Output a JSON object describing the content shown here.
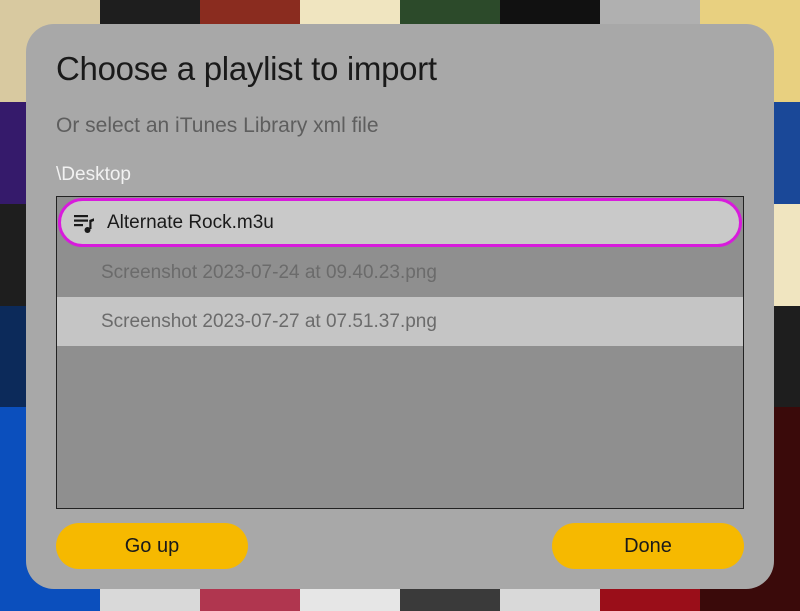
{
  "dialog": {
    "title": "Choose a playlist to import",
    "subtitle": "Or select an iTunes Library xml file",
    "path": "\\Desktop"
  },
  "files": [
    {
      "name": "Alternate Rock.m3u",
      "icon": "playlist-icon",
      "selected": true,
      "dim": false
    },
    {
      "name": "Screenshot 2023-07-24 at 09.40.23.png",
      "icon": "",
      "selected": false,
      "dim": true
    },
    {
      "name": "Screenshot 2023-07-27 at 07.51.37.png",
      "icon": "",
      "selected": false,
      "dim": true
    }
  ],
  "buttons": {
    "go_up": "Go up",
    "done": "Done"
  },
  "colors": {
    "accent_button": "#f6b900",
    "selection_ring": "#d81bdc"
  }
}
